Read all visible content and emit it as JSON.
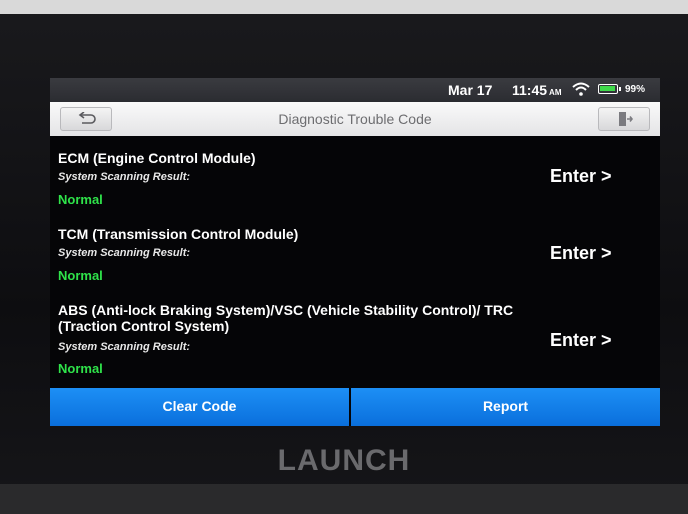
{
  "status": {
    "date": "Mar 17",
    "time": "11:45",
    "ampm": "AM",
    "battery": "99%"
  },
  "header": {
    "title": "Diagnostic Trouble Code"
  },
  "modules": [
    {
      "name": "ECM (Engine Control Module)",
      "scan_label": "System Scanning Result:",
      "result": "Normal",
      "enter_label": "Enter >"
    },
    {
      "name": "TCM (Transmission Control Module)",
      "scan_label": "System Scanning Result:",
      "result": "Normal",
      "enter_label": "Enter >"
    },
    {
      "name": "ABS (Anti-lock Braking System)/VSC (Vehicle Stability Control)/ TRC (Traction Control System)",
      "scan_label": "System Scanning Result:",
      "result": "Normal",
      "enter_label": "Enter >"
    }
  ],
  "footer": {
    "clear_label": "Clear Code",
    "report_label": "Report"
  },
  "brand": "LAUNCH",
  "colors": {
    "accent": "#1d8ff5",
    "result_ok": "#2fe34a"
  },
  "icons": [
    "back-arrow-icon",
    "exit-icon",
    "wifi-icon",
    "battery-icon"
  ]
}
